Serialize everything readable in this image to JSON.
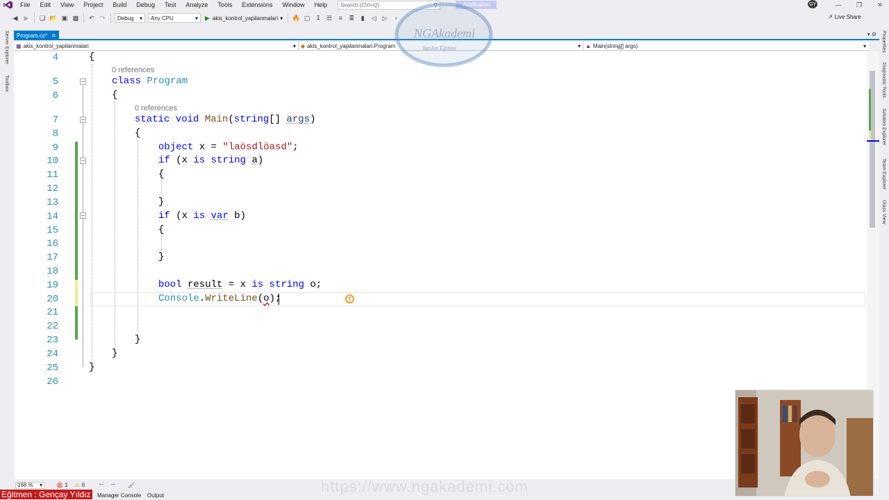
{
  "menu": {
    "items": [
      "File",
      "Edit",
      "View",
      "Project",
      "Build",
      "Debug",
      "Test",
      "Analyze",
      "Tools",
      "Extensions",
      "Window",
      "Help"
    ],
    "search_placeholder": "Search (Ctrl+Q)",
    "app_label": "Application",
    "avatar_initials": "GY"
  },
  "toolbar": {
    "config": "Debug",
    "platform": "Any CPU",
    "run_target": "akis_kontrol_yapilanmalari",
    "live_share": "Live Share"
  },
  "side_tabs": {
    "left": [
      "Server Explorer",
      "Toolbox"
    ],
    "right": [
      "Properties",
      "Diagnostic Tools",
      "Solution Explorer",
      "Team Explorer",
      "Class View"
    ]
  },
  "tab": {
    "label": "Program.cs*"
  },
  "nav": {
    "project": "akis_kontrol_yapilanmalari",
    "type": "akis_kontrol_yapilanmalari.Program",
    "member": "Main(string[] args)"
  },
  "editor": {
    "codelens_class": "0 references",
    "codelens_method": "0 references",
    "line_numbers": [
      "4",
      "5",
      "6",
      "7",
      "8",
      "9",
      "10",
      "11",
      "12",
      "13",
      "14",
      "15",
      "16",
      "17",
      "18",
      "19",
      "20",
      "21",
      "22",
      "23",
      "24",
      "25",
      "26"
    ],
    "code": {
      "l4": "{",
      "l5_kw": "class",
      "l5_name": "Program",
      "l6": "{",
      "l7_static": "static",
      "l7_void": "void",
      "l7_name": "Main",
      "l7_open": "(",
      "l7_string": "string",
      "l7_arr": "[] ",
      "l7_args": "args",
      "l7_close": ")",
      "l8": "{",
      "l9_object": "object",
      "l9_mid": " x = ",
      "l9_str": "\"laösdlöasd\"",
      "l9_end": ";",
      "l10_if": "if",
      "l10_a": " (x ",
      "l10_is": "is",
      "l10_sp": " ",
      "l10_string": "string",
      "l10_sp2": " ",
      "l10_var": "a",
      "l10_end": ")",
      "l11": "{",
      "l13": "}",
      "l14_if": "if",
      "l14_a": " (x ",
      "l14_is": "is",
      "l14_sp": " ",
      "l14_var": "var",
      "l14_end": " b)",
      "l15": "{",
      "l17": "}",
      "l19_bool": "bool",
      "l19_sp": " ",
      "l19_result": "result",
      "l19_mid": " = x ",
      "l19_is": "is",
      "l19_sp2": " ",
      "l19_string": "string",
      "l19_end": " o;",
      "l20_console": "Console",
      "l20_dot": ".",
      "l20_write": "WriteLine",
      "l20_open": "(",
      "l20_o": "o",
      "l20_end": ");",
      "l23": "}",
      "l24": "}",
      "l25": "}"
    }
  },
  "status": {
    "zoom": "168 %",
    "errors": "1",
    "warnings": "0"
  },
  "bottom": {
    "package_manager": "Manager Console",
    "output": "Output"
  },
  "overlay": {
    "instructor": "Eğitmen : Gençay Yıldız",
    "watermark_url": "https://www.ngakademi.com",
    "logo_text": "NGAkademi",
    "logo_sub": "Yazılım Eğitimi"
  },
  "colors": {
    "accent": "#007acc",
    "keyword": "#0000ff",
    "type": "#2b91af",
    "string": "#a31515",
    "change_saved": "#57a64a",
    "change_unsaved": "#efef91"
  }
}
